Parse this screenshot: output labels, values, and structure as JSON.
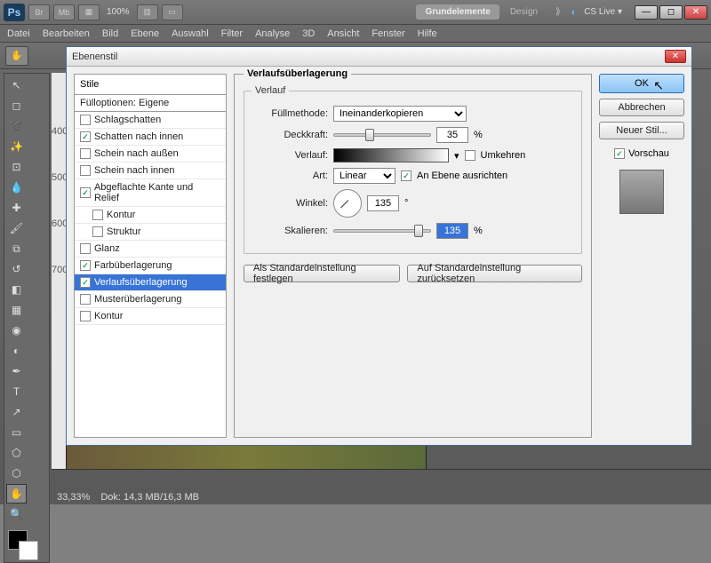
{
  "topbar": {
    "br": "Br",
    "mb": "Mb",
    "zoom": "100%",
    "essentials": "Grundelemente",
    "design": "Design",
    "more": "⟫",
    "cslive": "CS Live ▾"
  },
  "menu": {
    "file": "Datei",
    "edit": "Bearbeiten",
    "image": "Bild",
    "layer": "Ebene",
    "select": "Auswahl",
    "filter": "Filter",
    "analysis": "Analyse",
    "threed": "3D",
    "view": "Ansicht",
    "window": "Fenster",
    "help": "Hilfe"
  },
  "dialog": {
    "title": "Ebenenstil",
    "styles_header": "Stile",
    "fillopts": "Fülloptionen: Eigene",
    "items": [
      {
        "label": "Schlagschatten",
        "on": false
      },
      {
        "label": "Schatten nach innen",
        "on": true
      },
      {
        "label": "Schein nach außen",
        "on": false
      },
      {
        "label": "Schein nach innen",
        "on": false
      },
      {
        "label": "Abgeflachte Kante und Relief",
        "on": true
      },
      {
        "label": "Kontur",
        "on": false,
        "indent": true
      },
      {
        "label": "Struktur",
        "on": false,
        "indent": true
      },
      {
        "label": "Glanz",
        "on": false
      },
      {
        "label": "Farbüberlagerung",
        "on": true
      },
      {
        "label": "Verlaufsüberlagerung",
        "on": true,
        "sel": true
      },
      {
        "label": "Musterüberlagerung",
        "on": false
      },
      {
        "label": "Kontur",
        "on": false
      }
    ]
  },
  "panel": {
    "title": "Verlaufsüberlagerung",
    "group": "Verlauf",
    "blend_label": "Füllmethode:",
    "blend_val": "Ineinanderkopieren",
    "opacity_label": "Deckkraft:",
    "opacity_val": "35",
    "pct": "%",
    "grad_label": "Verlauf:",
    "reverse": "Umkehren",
    "style_label": "Art:",
    "style_val": "Linear",
    "align": "An Ebene ausrichten",
    "angle_label": "Winkel:",
    "angle_val": "135",
    "deg": "°",
    "scale_label": "Skalieren:",
    "scale_val": "135",
    "set_default": "Als Standardeinstellung festlegen",
    "reset_default": "Auf Standardeinstellung zurücksetzen"
  },
  "buttons": {
    "ok": "OK",
    "cancel": "Abbrechen",
    "newstyle": "Neuer Stil...",
    "preview": "Vorschau"
  },
  "status": {
    "zoom": "33,33%",
    "doc": "Dok: 14,3 MB/16,3 MB"
  }
}
